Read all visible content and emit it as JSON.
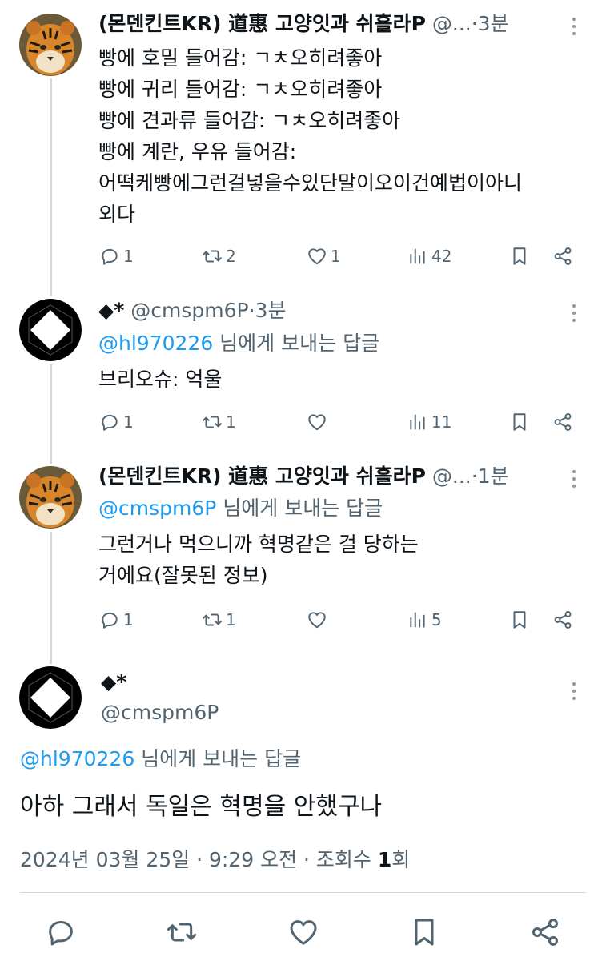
{
  "tweets": [
    {
      "name": "(몬덴킨트KR) 道惠 고양잇과 쉬흘라P",
      "handle": "@...",
      "time": "3분",
      "lines": [
        "빵에 호밀 들어감: ㄱㅊ오히려좋아",
        "빵에 귀리 들어감: ㄱㅊ오히려좋아",
        "빵에 견과류 들어감: ㄱㅊ오히려좋아",
        "빵에 계란, 우유 들어감:",
        "어떡케빵에그런걸넣을수있단말이오이건예법이아니",
        "외다"
      ],
      "stats": {
        "replies": "1",
        "retweets": "2",
        "likes": "1",
        "views": "42"
      }
    },
    {
      "name": "◆*",
      "handle": "@cmspm6P",
      "time": "3분",
      "replying_mention": "@hl970226",
      "replying_suffix": " 님에게 보내는 답글",
      "lines": [
        "브리오슈: 억울"
      ],
      "stats": {
        "replies": "1",
        "retweets": "1",
        "likes": "",
        "views": "11"
      }
    },
    {
      "name": "(몬덴킨트KR) 道惠 고양잇과 쉬흘라P",
      "handle": "@...",
      "time": "1분",
      "replying_mention": "@cmspm6P",
      "replying_suffix": " 님에게 보내는 답글",
      "lines": [
        "그런거나 먹으니까 혁명같은 걸 당하는",
        "거에요(잘못된 정보)"
      ],
      "stats": {
        "replies": "1",
        "retweets": "1",
        "likes": "",
        "views": "5"
      }
    }
  ],
  "main_tweet": {
    "name": "◆*",
    "handle": "@cmspm6P",
    "replying_mention": "@hl970226",
    "replying_suffix": " 님에게 보내는 답글",
    "text": "아하 그래서 독일은 혁명을 안했구나",
    "timestamp": "2024년 03월 25일 · 9:29 오전 · 조회수 ",
    "views_count": "1",
    "views_suffix": "회"
  },
  "separator": " · ",
  "icons": {
    "reply": "reply-icon",
    "retweet": "retweet-icon",
    "like": "heart-icon",
    "views": "views-chart-icon",
    "bookmark": "bookmark-icon",
    "share": "share-icon",
    "more": "more-vertical-icon"
  },
  "colors": {
    "text": "#0f1419",
    "secondary": "#536471",
    "mention": "#1d9bf0",
    "thread_line": "#cfd9de"
  }
}
